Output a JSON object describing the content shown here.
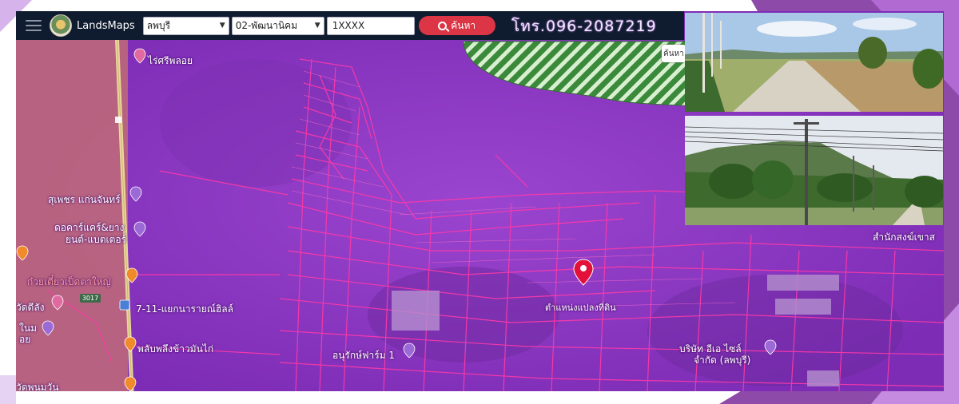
{
  "app": {
    "brand": "LandsMaps",
    "phone": "โทร.096-2087219"
  },
  "search": {
    "province": "ลพบุรี",
    "district": "02-พัฒนานิคม",
    "parcel_value": "1XXXX",
    "button_label": "ค้นหา",
    "side_tab": "ค้นหา"
  },
  "map_labels": {
    "place1": "ไร่ศรีพลอย",
    "place2": "สุเพชร แก่นจันทร์",
    "place3": "ดอคาร์แคร์&ยาง",
    "place3b": "ยนต์-แบตเตอร์",
    "place4": "ก๋วยเตี๋ยวเป็ดตาใหญ่",
    "place5": "7-11-แยกนารายณ์ฮิลล์",
    "place6": "พลับพลึงข้าวมันไก่",
    "place7": "อนุรักษ์ฟาร์ม 1",
    "place8": "ตำแหน่งแปลงที่ดิน",
    "place9": "สำนักสงฆ์เขาส",
    "place10": "บริษัท อีเอ ไซล์",
    "place10b": "จำกัด (ลพบุรี)",
    "place11": "วัดดีลัง",
    "place12": "ในม",
    "place13": "อย",
    "place14": "วัดพนมวัน",
    "road_badge": "3017"
  },
  "colors": {
    "overlay": "#8a35c0",
    "toolbar": "#0f1b2e",
    "button": "#dc3545",
    "parcel_lines": "#ff3aa8",
    "forest": "#3b8a3b"
  }
}
